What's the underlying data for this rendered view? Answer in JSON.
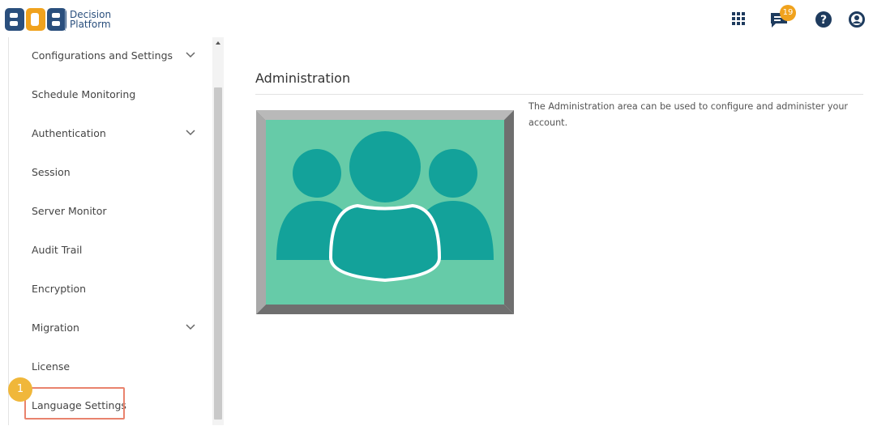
{
  "header": {
    "logo_text_line1": "Decision",
    "logo_text_line2": "Platform",
    "notification_count": "19"
  },
  "sidebar": {
    "items": [
      {
        "label": "Configurations and Settings",
        "has_chevron": true
      },
      {
        "label": "Schedule Monitoring",
        "has_chevron": false
      },
      {
        "label": "Authentication",
        "has_chevron": true
      },
      {
        "label": "Session",
        "has_chevron": false
      },
      {
        "label": "Server Monitor",
        "has_chevron": false
      },
      {
        "label": "Audit Trail",
        "has_chevron": false
      },
      {
        "label": "Encryption",
        "has_chevron": false
      },
      {
        "label": "Migration",
        "has_chevron": true
      },
      {
        "label": "License",
        "has_chevron": false
      },
      {
        "label": "Language Settings",
        "has_chevron": false
      }
    ],
    "highlight_step": "1"
  },
  "main": {
    "title": "Administration",
    "description": "The Administration area can be used to configure and administer your account."
  },
  "colors": {
    "brand_blue": "#2a4f7d",
    "badge_orange": "#f0a21d",
    "highlight_border": "#e9836d",
    "illustration_bg": "#66cba8",
    "illustration_people": "#13a29a"
  },
  "icons": [
    "apps-grid-icon",
    "chat-notification-icon",
    "help-icon",
    "user-account-icon",
    "chevron-down-icon"
  ]
}
